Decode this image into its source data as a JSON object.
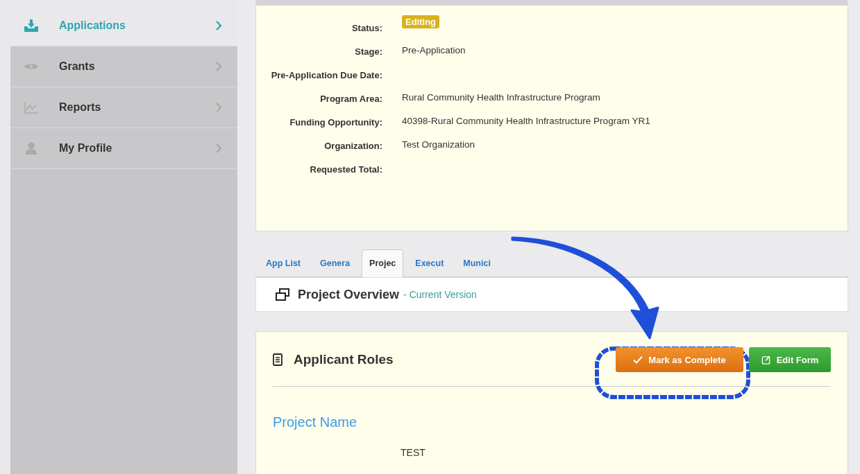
{
  "sidebar": {
    "items": [
      {
        "label": "Applications",
        "selected": true
      },
      {
        "label": "Grants",
        "selected": false
      },
      {
        "label": "Reports",
        "selected": false
      },
      {
        "label": "My Profile",
        "selected": false
      }
    ]
  },
  "summary": {
    "status_badge": "Editing",
    "fields": [
      {
        "label": "Status:"
      },
      {
        "label": "Stage:",
        "value": "Pre-Application"
      },
      {
        "label": "Pre-Application Due Date:"
      },
      {
        "label": "Program Area:",
        "value": "Rural Community Health Infrastructure Program"
      },
      {
        "label": "Funding Opportunity:",
        "value": "40398-Rural Community Health Infrastructure Program YR1"
      },
      {
        "label": "Organization:",
        "value": "Test Organization"
      },
      {
        "label": "Requested Total:"
      }
    ]
  },
  "tabs": [
    {
      "label": "App List",
      "selected": false
    },
    {
      "label": "Genera",
      "selected": false
    },
    {
      "label": "Projec",
      "selected": true
    },
    {
      "label": "Execut",
      "selected": false
    },
    {
      "label": "Munici",
      "selected": false
    }
  ],
  "overview": {
    "title": "Project Overview",
    "subtitle": "- Current Version"
  },
  "section": {
    "title": "Applicant Roles",
    "buttons": [
      {
        "kind": "complete",
        "label": "Mark as Complete"
      },
      {
        "kind": "edit",
        "label": "Edit Form"
      }
    ],
    "field_heading": "Project Name",
    "field_value": "TEST"
  }
}
